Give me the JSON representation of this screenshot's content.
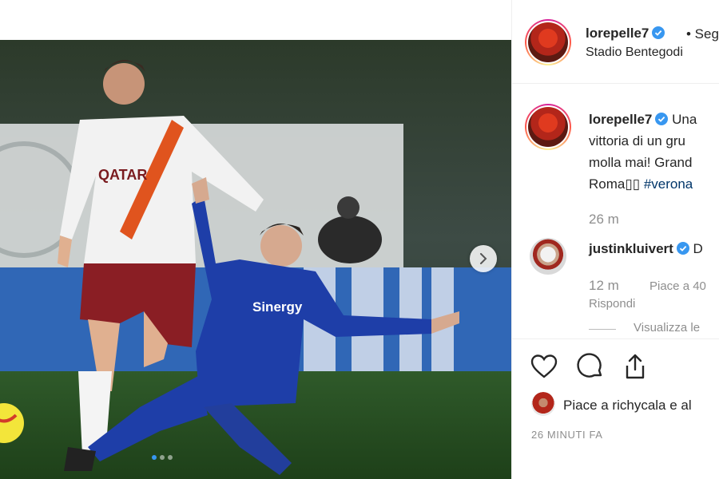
{
  "post": {
    "media_alt": "",
    "carousel": {
      "total": 3,
      "active": 0
    }
  },
  "header": {
    "username": "lorepelle7",
    "follow_suffix": "• Seg",
    "location": "Stadio Bentegodi"
  },
  "caption": {
    "username": "lorepelle7",
    "line1_rest": "Una",
    "line2": "vittoria di un gru",
    "line3": "molla mai! Grand",
    "line4_text": "Roma",
    "line4_emoji": "▯▯",
    "line4_tag": "#verona",
    "age": "26 m"
  },
  "comment": {
    "username": "justinkluivert",
    "text_start": "D",
    "age": "12 m",
    "likes": "Piace a 40",
    "reply": "Rispondi",
    "view_replies": "Visualizza le"
  },
  "footer": {
    "likes_text": "Piace a richycala e al",
    "timestamp": "26 MINUTI FA"
  },
  "colors": {
    "verified": "#3897f0",
    "hashtag": "#003569",
    "muted": "#8e8e8e"
  },
  "icons": {
    "like": "heart-icon",
    "comment": "comment-icon",
    "share": "share-icon",
    "next": "chevron-right-icon",
    "verified": "verified-badge-icon"
  }
}
